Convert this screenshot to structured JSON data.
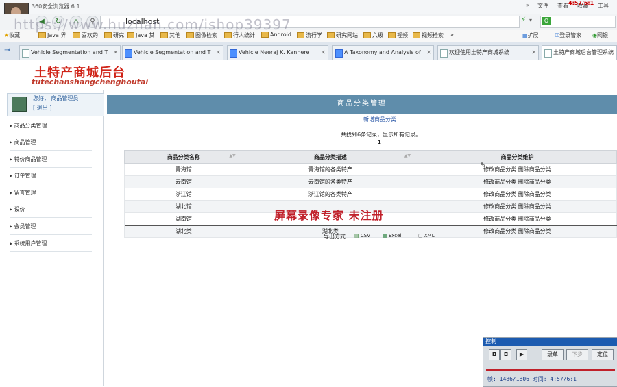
{
  "browser": {
    "title": "360安全浏览器 6.1",
    "url": "localhost",
    "time_overlay": "4:57/6:1",
    "top_menu": [
      "文件",
      "查看",
      "收藏",
      "工具"
    ],
    "toolbar_right": [
      "扩展",
      "登录管家",
      "网银"
    ],
    "favorites": [
      "收藏",
      "Java 界",
      "喜欢的",
      "研究",
      "Java 其",
      "其他",
      "图像检索",
      "行人统计",
      "Android",
      "流行学",
      "研究网站",
      "六级",
      "视频",
      "视频检索"
    ],
    "tabs": [
      {
        "label": "Vehicle Segmentation and T",
        "icon": "page-icon"
      },
      {
        "label": "Vehicle Segmentation and T",
        "icon": "google-icon"
      },
      {
        "label": "Vehicle Neeraj K. Kanhere",
        "icon": "google-icon"
      },
      {
        "label": "A Taxonomy and Analysis of",
        "icon": "google-icon"
      },
      {
        "label": "欢迎使用土特产商城系统",
        "icon": "image-icon"
      },
      {
        "label": "土特产商城后台管理系统",
        "icon": "image-icon"
      }
    ]
  },
  "site": {
    "logo_cn": "土特产商城后台",
    "logo_pinyin": "tutechanshangchenghoutai",
    "watermark_url": "https://www.huzhan.com/ishop39397",
    "watermark_recorder": "屏幕录像专家 未注册"
  },
  "user": {
    "greeting": "您好，  商品管理员",
    "logout": "[  退出  ]"
  },
  "nav": [
    "商品分类管理",
    "商品管理",
    "特价商品管理",
    "订单管理",
    "留言管理",
    "设价",
    "会员管理",
    "系统用户管理"
  ],
  "main": {
    "header": "商品分类管理",
    "add_link": "新增商品分类",
    "record_info": "共找到6条记录，显示所有记录。",
    "page_number": "1",
    "columns": [
      "商品分类名称",
      "商品分类描述",
      "商品分类维护"
    ],
    "rows": [
      {
        "name": "青海馆",
        "desc": "青海馆的各类特产",
        "edit": "修改商品分类",
        "delete": "删除商品分类"
      },
      {
        "name": "云南馆",
        "desc": "云南馆的各类特产",
        "edit": "修改商品分类",
        "delete": "删除商品分类"
      },
      {
        "name": "浙江馆",
        "desc": "浙江馆的各类特产",
        "edit": "修改商品分类",
        "delete": "删除商品分类"
      },
      {
        "name": "湖北馆",
        "desc": "",
        "edit": "修改商品分类",
        "delete": "删除商品分类"
      },
      {
        "name": "湖南馆",
        "desc": "",
        "edit": "修改商品分类",
        "delete": "删除商品分类"
      },
      {
        "name": "湖北类",
        "desc": "湖北类",
        "edit": "修改商品分类",
        "delete": "删除商品分类"
      }
    ],
    "export_label": "导出方式:",
    "export_options": [
      "CSV",
      "Excel",
      "XML"
    ]
  },
  "player": {
    "title": "控制",
    "btn_record": "录单",
    "btn_next": "下步",
    "btn_locate": "定位",
    "status": "帧: 1486/1806 时间: 4:57/6:1"
  },
  "colors": {
    "header_bg": "#5f8dab",
    "logo_red": "#d02418",
    "accent_blue": "#1c5bb0"
  }
}
